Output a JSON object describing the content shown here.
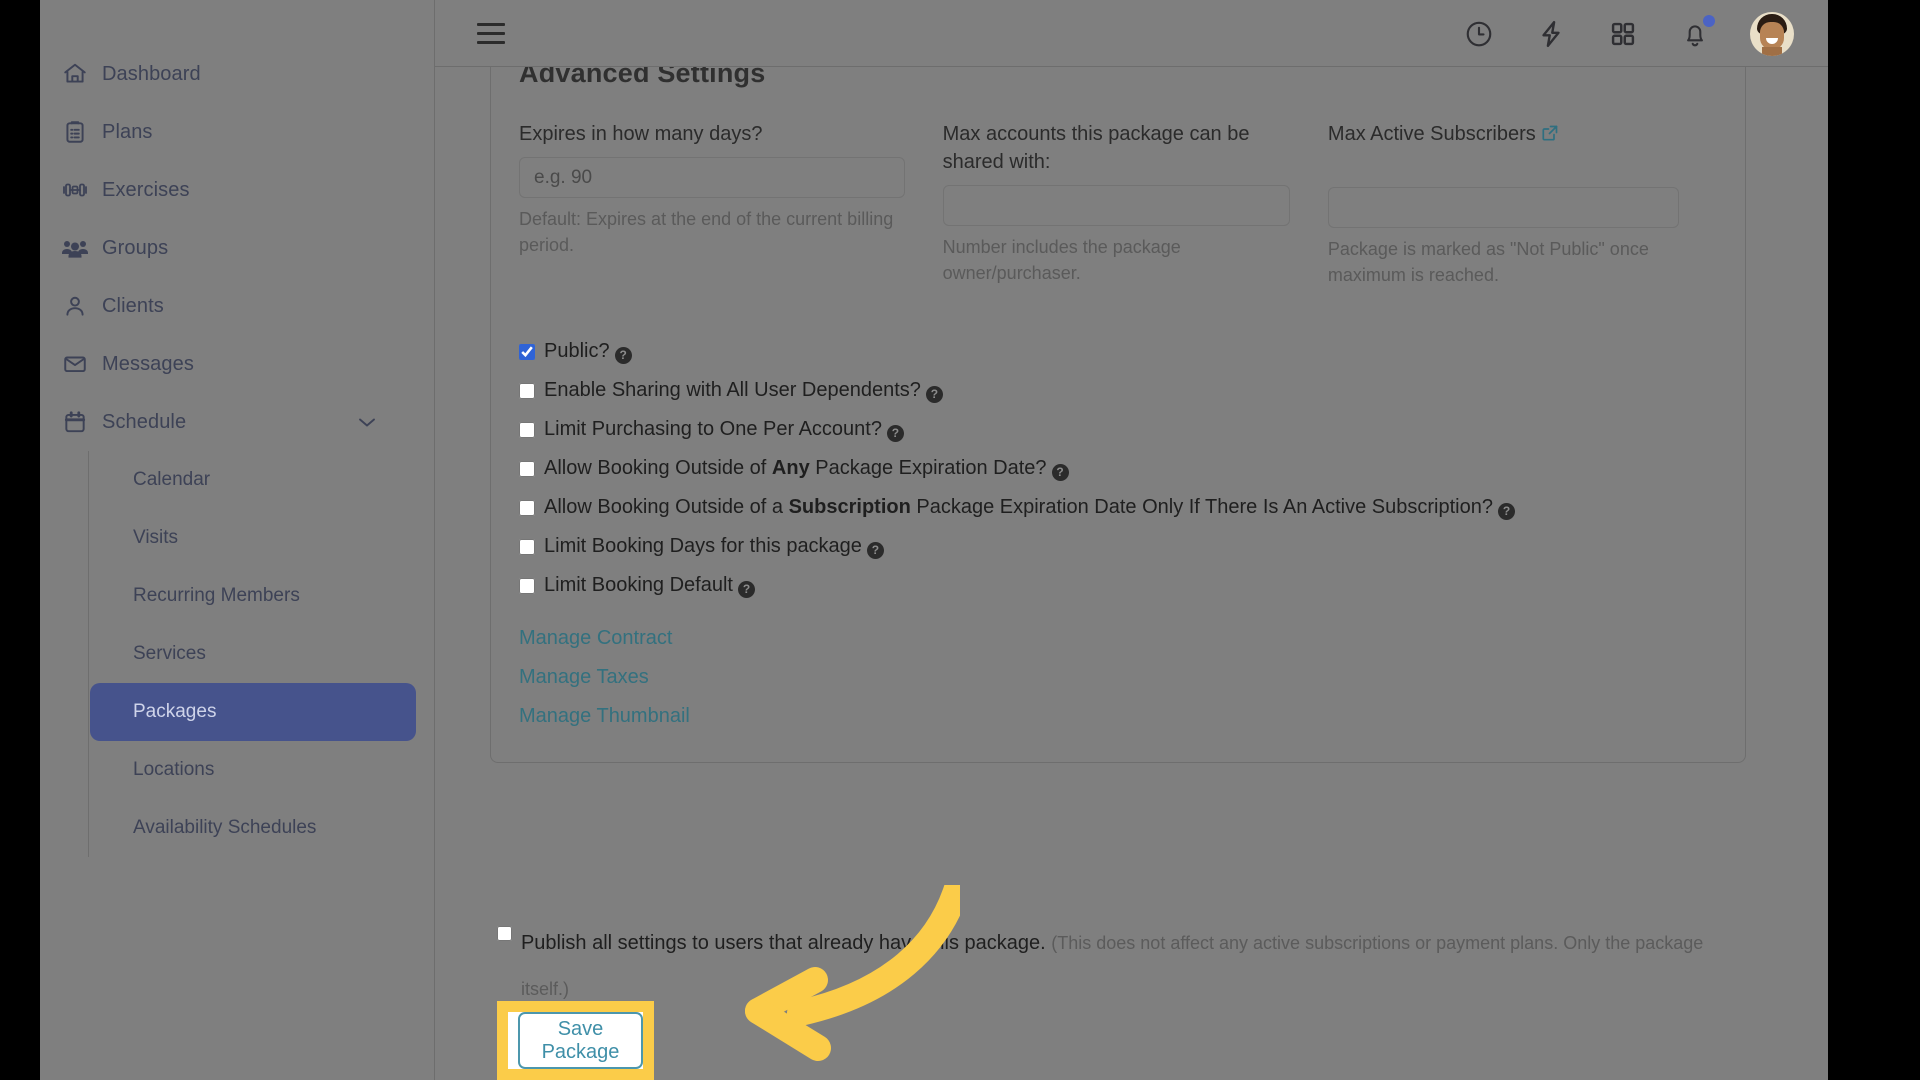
{
  "sidebar": {
    "items": [
      {
        "label": "Dashboard",
        "icon": "home-icon"
      },
      {
        "label": "Plans",
        "icon": "clipboard-icon"
      },
      {
        "label": "Exercises",
        "icon": "dumbbell-icon"
      },
      {
        "label": "Groups",
        "icon": "groups-icon"
      },
      {
        "label": "Clients",
        "icon": "user-icon"
      },
      {
        "label": "Messages",
        "icon": "envelope-icon"
      },
      {
        "label": "Schedule",
        "icon": "calendar-icon",
        "expanded": true
      }
    ],
    "schedule_children": [
      {
        "label": "Calendar",
        "active": false
      },
      {
        "label": "Visits",
        "active": false
      },
      {
        "label": "Recurring Members",
        "active": false
      },
      {
        "label": "Services",
        "active": false
      },
      {
        "label": "Packages",
        "active": true
      },
      {
        "label": "Locations",
        "active": false
      },
      {
        "label": "Availability Schedules",
        "active": false
      }
    ],
    "active_color": "#46538c"
  },
  "topbar": {
    "menu_icon": "hamburger-icon",
    "icons": [
      {
        "name": "clock-icon"
      },
      {
        "name": "lightning-icon"
      },
      {
        "name": "apps-grid-icon"
      },
      {
        "name": "bell-icon",
        "has_badge": true
      }
    ],
    "badge_color": "#4b63c4",
    "avatar": "user-avatar"
  },
  "card": {
    "title": "Advanced Settings",
    "fields": [
      {
        "label": "Expires in how many days?",
        "placeholder": "e.g. 90",
        "value": "",
        "hint": "Default: Expires at the end of the current billing period."
      },
      {
        "label": "Max accounts this package can be shared with:",
        "placeholder": "",
        "value": "",
        "hint": "Number includes the package owner/purchaser."
      },
      {
        "label": "Max Active Subscribers",
        "label_icon": "external-link-icon",
        "placeholder": "",
        "value": "",
        "hint": "Package is marked as \"Not Public\" once maximum is reached."
      }
    ],
    "checkboxes": [
      {
        "label": "Public?",
        "checked": true,
        "has_help": true
      },
      {
        "label": "Enable Sharing with All User Dependents?",
        "checked": false,
        "has_help": true
      },
      {
        "label": "Limit Purchasing to One Per Account?",
        "checked": false,
        "has_help": true
      },
      {
        "label": "Allow Booking Outside of ",
        "bold": "Any",
        "label_after": " Package Expiration Date?",
        "checked": false,
        "has_help": true
      },
      {
        "label": "Allow Booking Outside of a ",
        "bold": "Subscription",
        "label_after": " Package Expiration Date Only If There Is An Active Subscription?",
        "checked": false,
        "has_help": true
      },
      {
        "label": "Limit Booking Days for this package",
        "checked": false,
        "has_help": true
      },
      {
        "label": "Limit Booking Default",
        "checked": false,
        "has_help": true
      }
    ],
    "links": [
      {
        "label": "Manage Contract"
      },
      {
        "label": "Manage Taxes"
      },
      {
        "label": "Manage Thumbnail"
      }
    ],
    "link_color": "#33717f"
  },
  "footer": {
    "publish_checkbox_checked": false,
    "publish_label": "Publish all settings to users that already have this package.",
    "publish_note": "(This does not affect any active subscriptions or payment plans. Only the package itself.)",
    "save_label": "Save Package",
    "highlight_color": "#fbcc49",
    "save_border_color": "#4c97ad",
    "save_text_color": "#3f8fa8"
  },
  "annotation": {
    "arrow": "curved-arrow-pointing-left",
    "arrow_color": "#fbcc49"
  }
}
